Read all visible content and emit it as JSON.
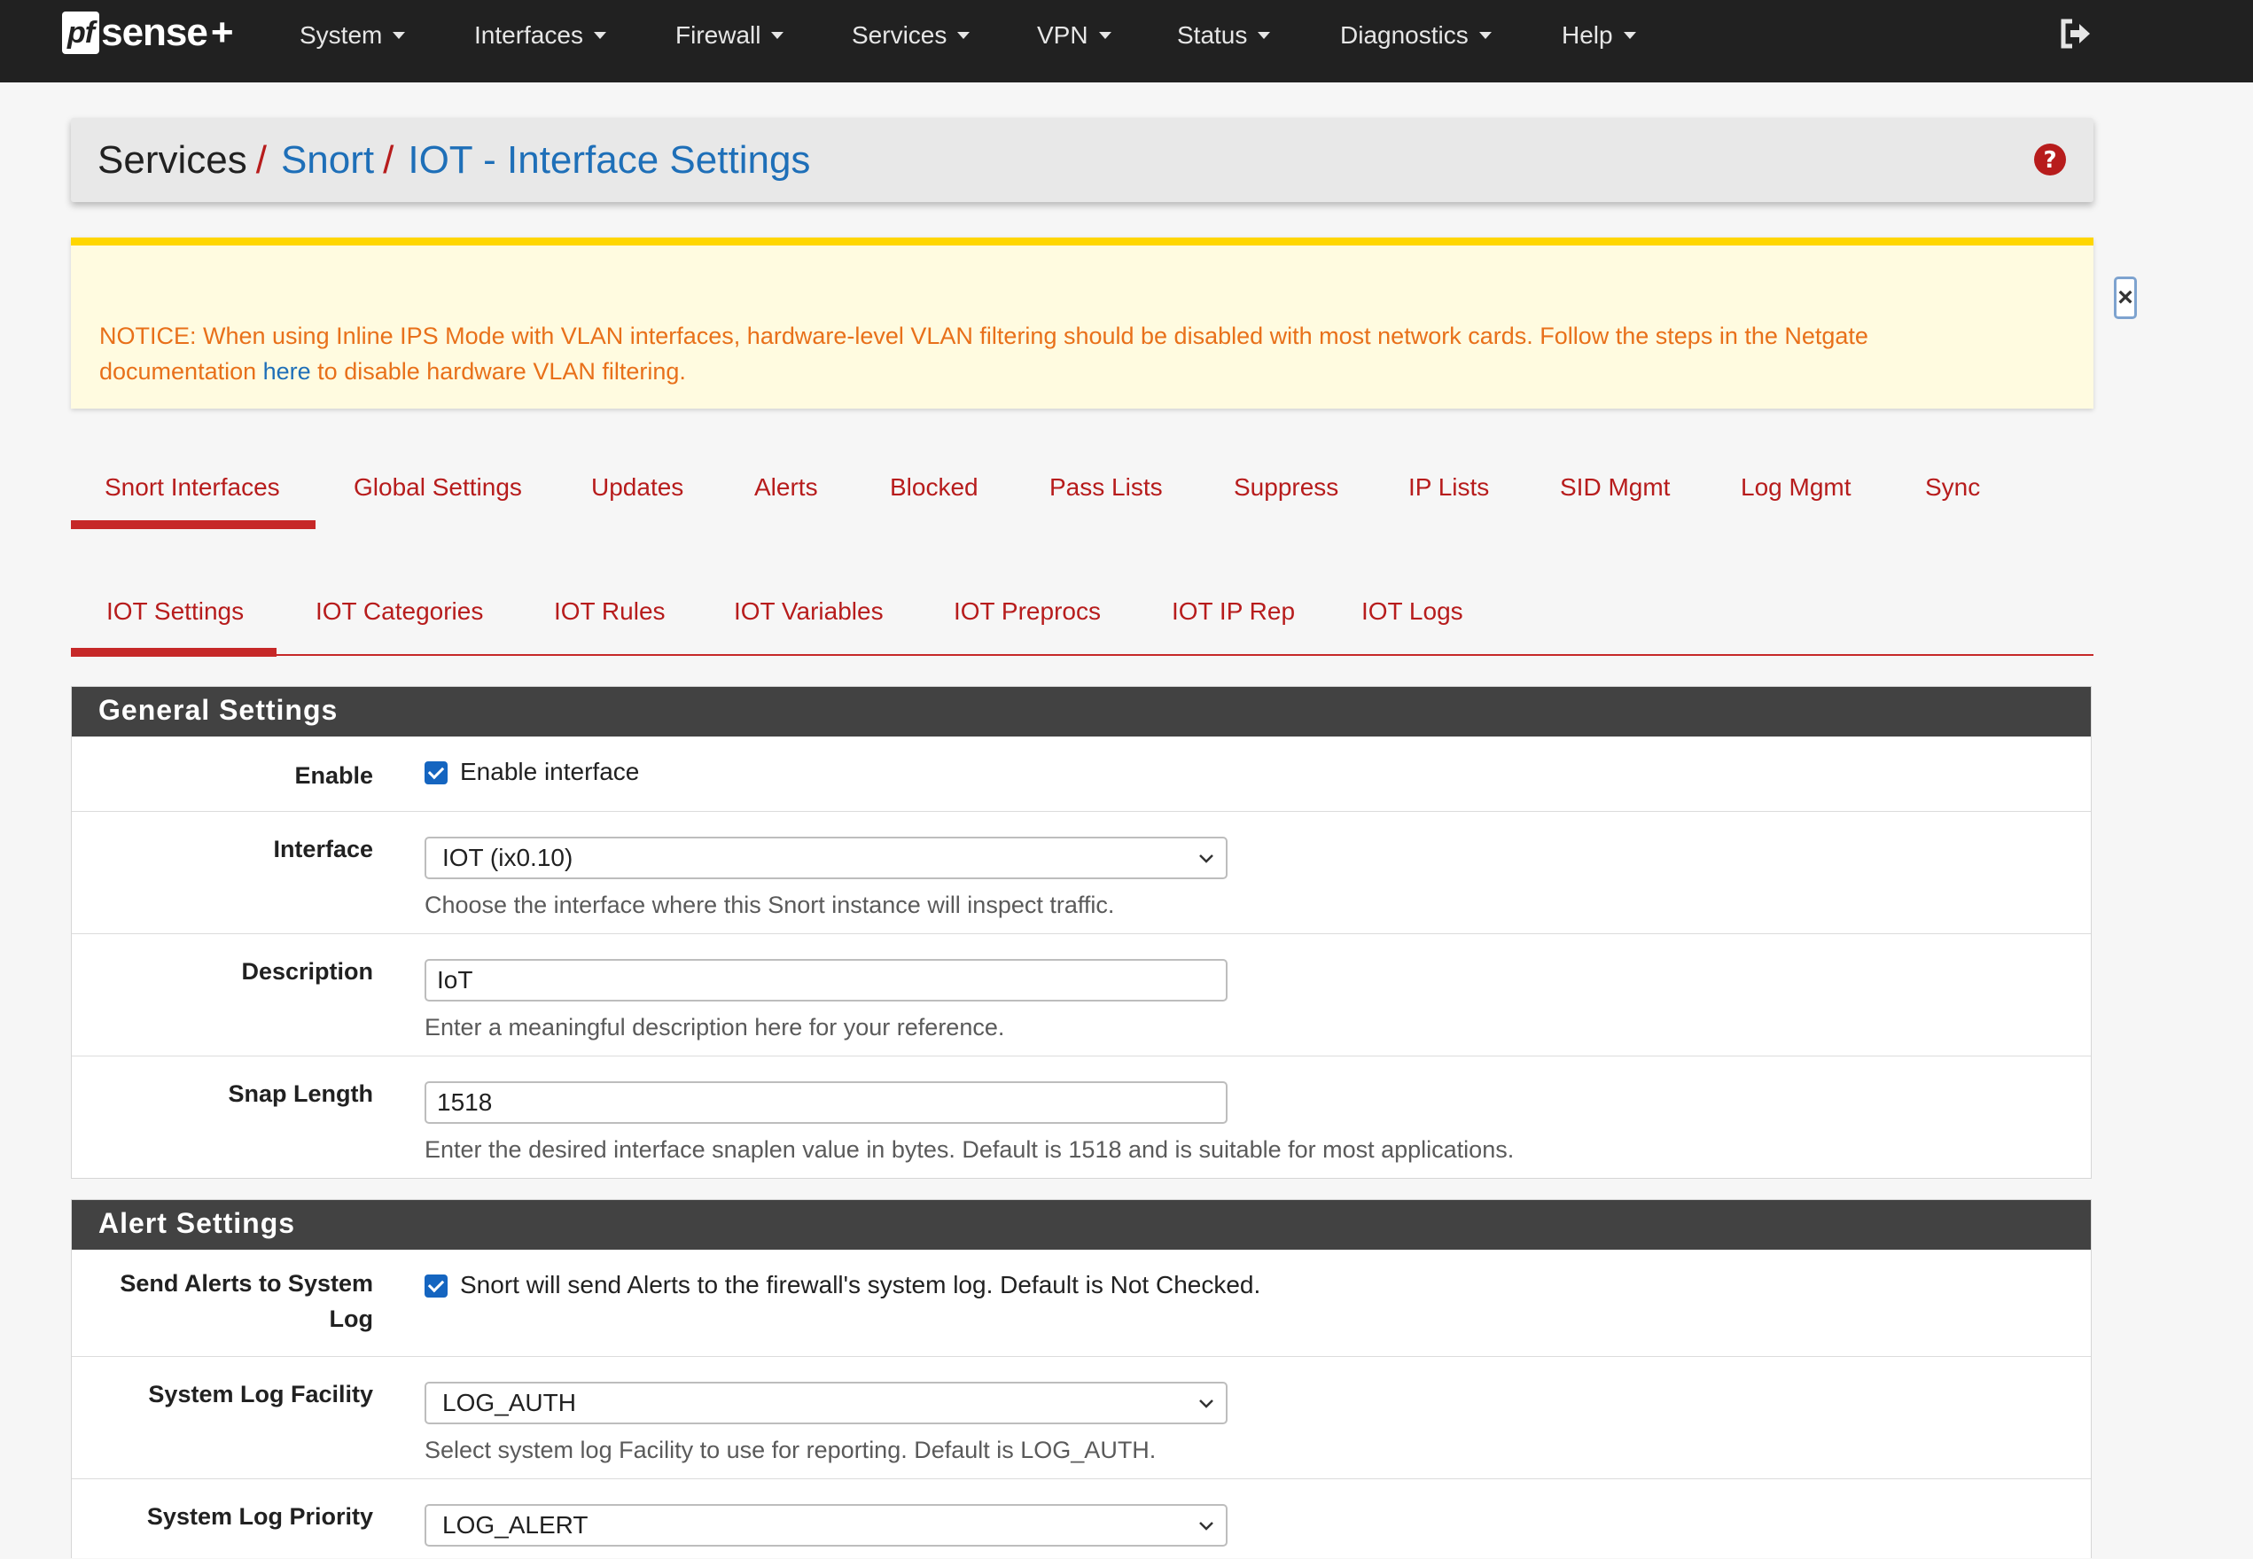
{
  "navbar": {
    "logo_pf": "pf",
    "logo_sense": "sense",
    "logo_plus": "+",
    "menu": [
      "System",
      "Interfaces",
      "Firewall",
      "Services",
      "VPN",
      "Status",
      "Diagnostics",
      "Help"
    ],
    "logout_icon": "logout-icon"
  },
  "breadcrumb": {
    "root": "Services",
    "sep": "/",
    "level1": "Snort",
    "level2": "IOT - Interface Settings",
    "help_icon": "question-circle-icon"
  },
  "notice": {
    "text_before": "NOTICE: When using Inline IPS Mode with VLAN interfaces, hardware-level VLAN filtering should be disabled with most network cards. Follow the steps in the Netgate documentation ",
    "link": "here",
    "text_after": " to disable hardware VLAN filtering.",
    "close": "×"
  },
  "tabs_main": [
    "Snort Interfaces",
    "Global Settings",
    "Updates",
    "Alerts",
    "Blocked",
    "Pass Lists",
    "Suppress",
    "IP Lists",
    "SID Mgmt",
    "Log Mgmt",
    "Sync"
  ],
  "tabs_iface": [
    "IOT Settings",
    "IOT Categories",
    "IOT Rules",
    "IOT Variables",
    "IOT Preprocs",
    "IOT IP Rep",
    "IOT Logs"
  ],
  "general": {
    "heading": "General Settings",
    "enable_label": "Enable",
    "enable_text": "Enable interface",
    "interface_label": "Interface",
    "interface_value": "IOT (ix0.10)",
    "interface_help": "Choose the interface where this Snort instance will inspect traffic.",
    "description_label": "Description",
    "description_value": "IoT",
    "description_help": "Enter a meaningful description here for your reference.",
    "snap_label": "Snap Length",
    "snap_value": "1518",
    "snap_help": "Enter the desired interface snaplen value in bytes. Default is 1518 and is suitable for most applications."
  },
  "alert": {
    "heading": "Alert Settings",
    "syslog_label_1": "Send Alerts to System",
    "syslog_label_2": "Log",
    "syslog_text": "Snort will send Alerts to the firewall's system log. Default is Not Checked.",
    "facility_label": "System Log Facility",
    "facility_value": "LOG_AUTH",
    "facility_help": "Select system log Facility to use for reporting. Default is LOG_AUTH.",
    "priority_label": "System Log Priority",
    "priority_value": "LOG_ALERT"
  },
  "colors": {
    "navbar": "#212121",
    "accent_red": "#b71c1c",
    "link_blue": "#1e6fb8",
    "notice_text": "#e8701a",
    "notice_bg": "#fffbe0",
    "panel_heading": "#424242",
    "checkbox": "#1565c0"
  }
}
